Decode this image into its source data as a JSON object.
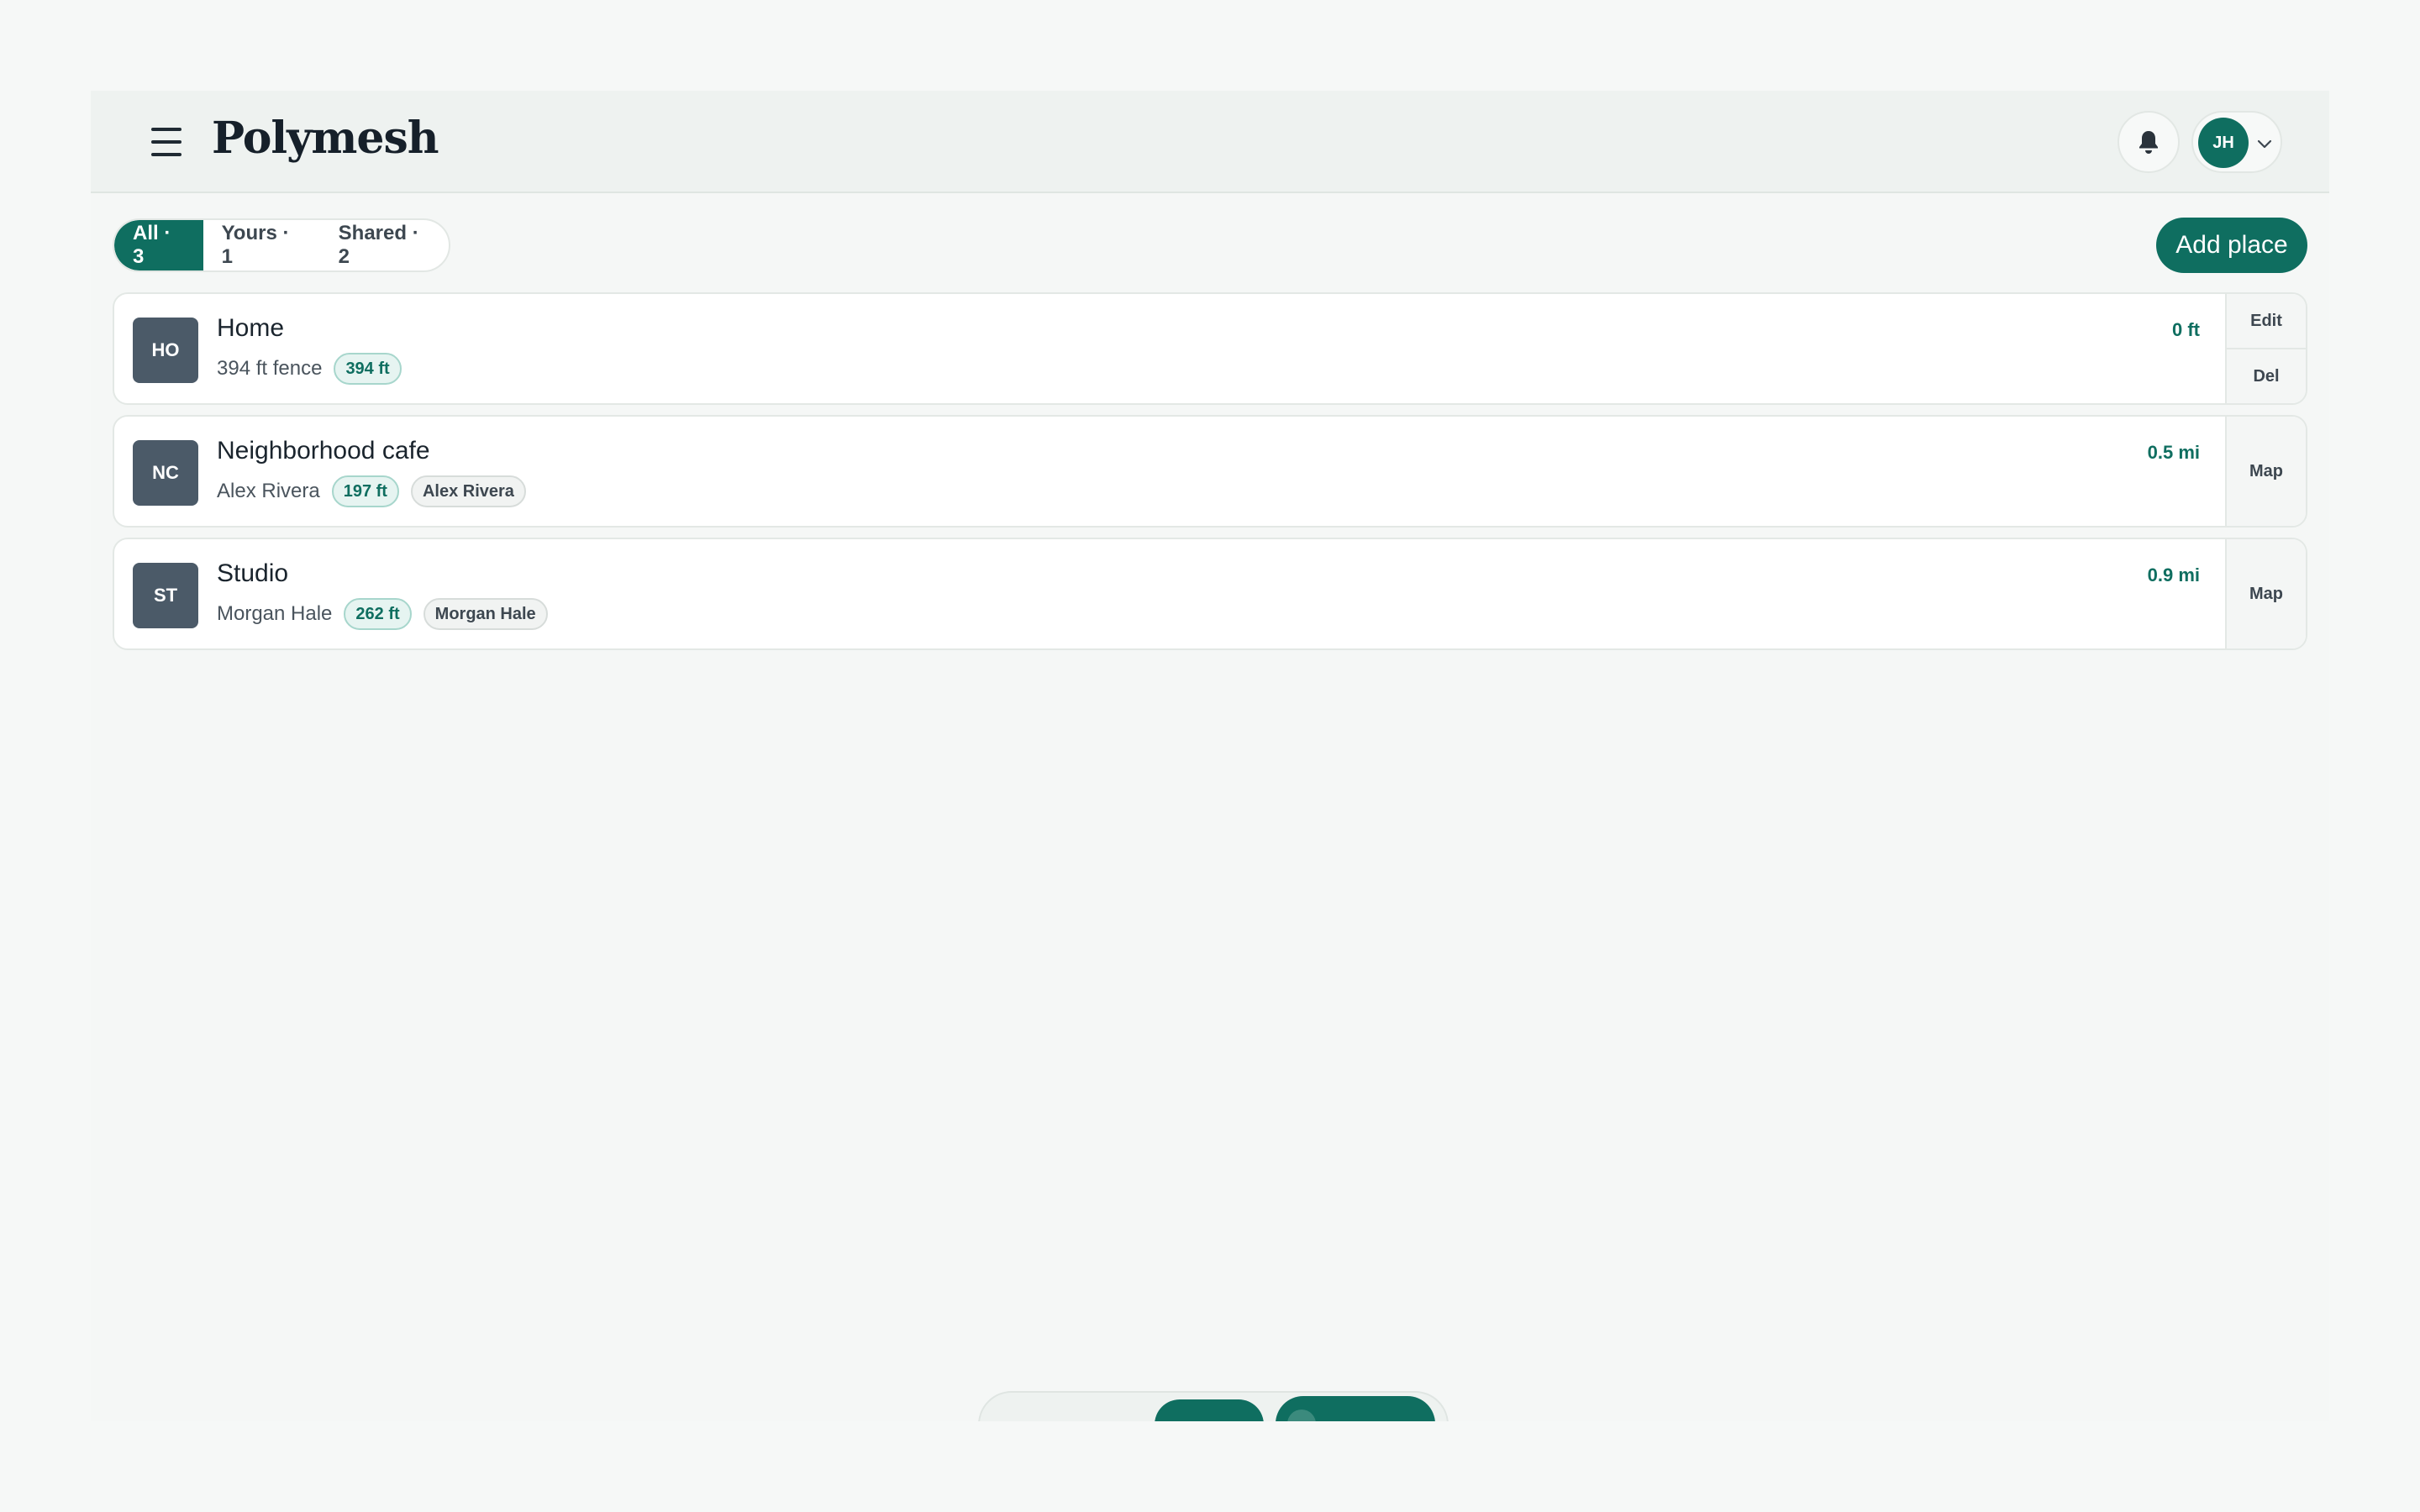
{
  "header": {
    "brand": "Polymesh",
    "user_initials": "JH"
  },
  "filters": [
    {
      "label": "All · 3",
      "active": true
    },
    {
      "label": "Yours · 1",
      "active": false
    },
    {
      "label": "Shared · 2",
      "active": false
    }
  ],
  "add_button": "Add place",
  "places": [
    {
      "initials": "HO",
      "name": "Home",
      "subtitle": "394 ft fence",
      "badge": "394 ft",
      "owner_badge": "",
      "distance": "0 ft",
      "actions": [
        "Edit",
        "Del"
      ]
    },
    {
      "initials": "NC",
      "name": "Neighborhood cafe",
      "subtitle": "Alex Rivera",
      "badge": "197 ft",
      "owner_badge": "Alex Rivera",
      "distance": "0.5 mi",
      "actions": [
        "Map"
      ]
    },
    {
      "initials": "ST",
      "name": "Studio",
      "subtitle": "Morgan Hale",
      "badge": "262 ft",
      "owner_badge": "Morgan Hale",
      "distance": "0.9 mi",
      "actions": [
        "Map"
      ]
    }
  ],
  "colors": {
    "accent": "#0f6e60",
    "tile": "#4b5a68",
    "background": "#f5f7f6"
  },
  "icons": {
    "menu": "menu-icon",
    "bell": "bell-icon",
    "chevron": "chevron-down-icon"
  }
}
